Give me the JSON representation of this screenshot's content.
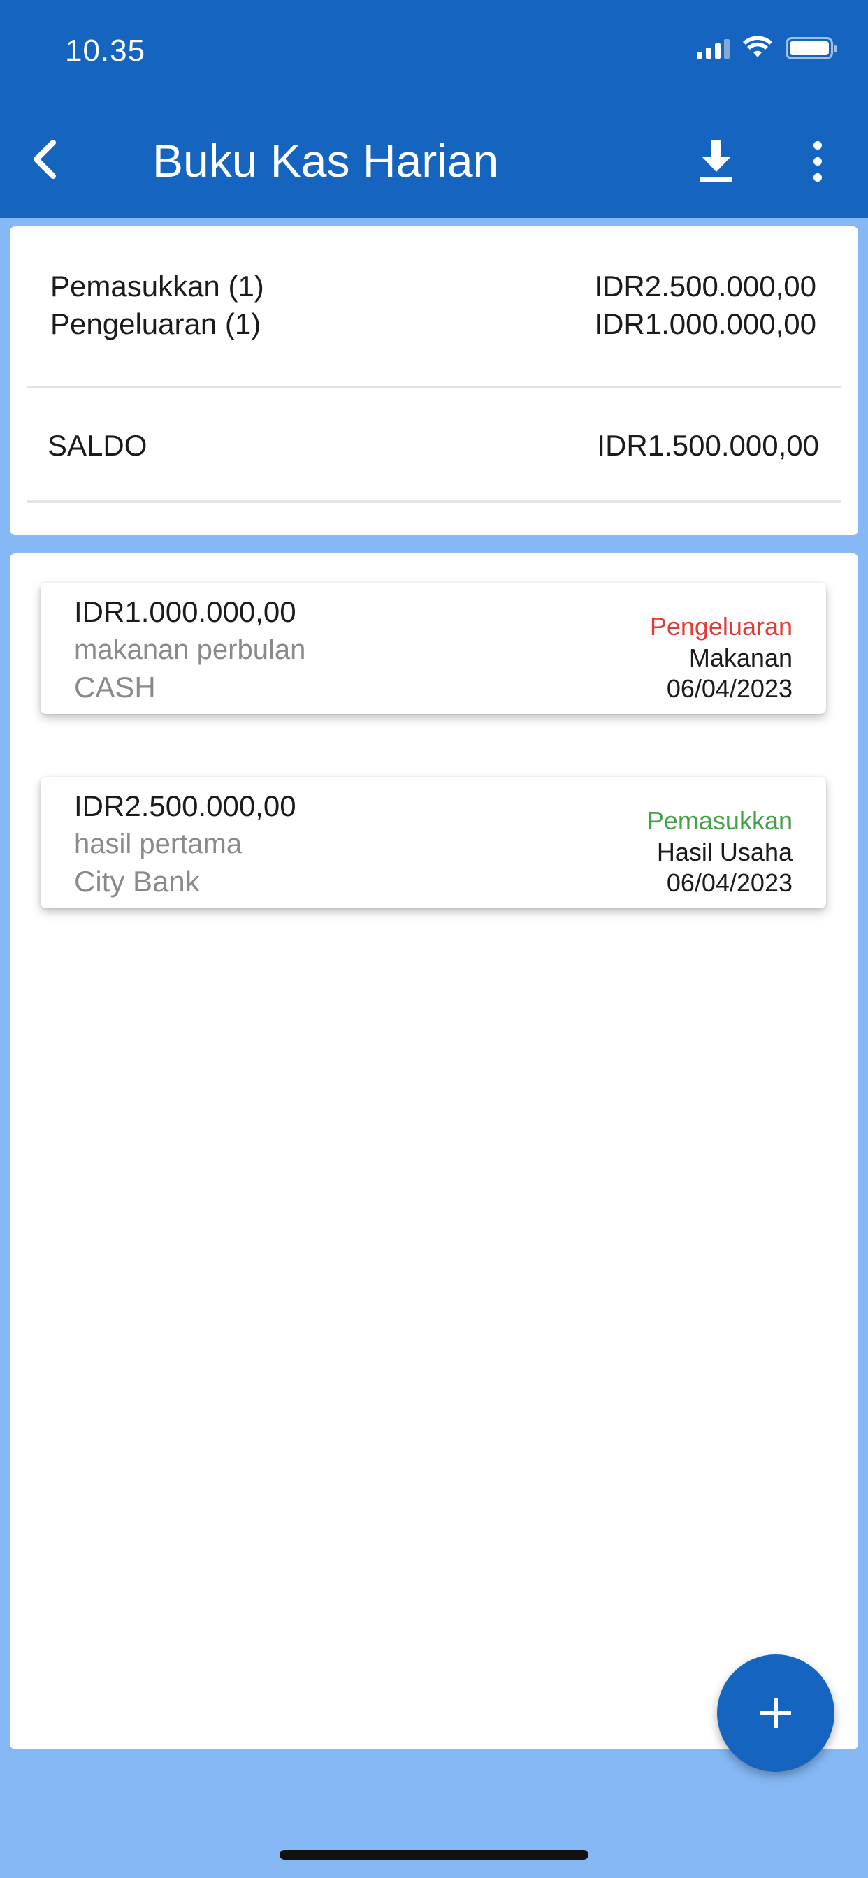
{
  "status_bar": {
    "time": "10.35"
  },
  "header": {
    "title": "Buku Kas Harian"
  },
  "summary": {
    "income_label": "Pemasukkan (1)",
    "income_amount": "IDR2.500.000,00",
    "expense_label": "Pengeluaran (1)",
    "expense_amount": "IDR1.000.000,00",
    "balance_label": "SALDO",
    "balance_amount": "IDR1.500.000,00"
  },
  "transactions": [
    {
      "amount": "IDR1.000.000,00",
      "note": "makanan perbulan",
      "account": "CASH",
      "type": "Pengeluaran",
      "category": "Makanan",
      "date": "06/04/2023"
    },
    {
      "amount": "IDR2.500.000,00",
      "note": "hasil pertama",
      "account": "City Bank",
      "type": "Pemasukkan",
      "category": "Hasil Usaha",
      "date": "06/04/2023"
    }
  ],
  "colors": {
    "primary": "#1565c0",
    "background": "#85b8f5",
    "expense": "#e53935",
    "income": "#43a047"
  },
  "icons": {
    "back": "back-arrow-icon",
    "download": "download-icon",
    "menu": "more-vert-icon",
    "add": "plus-icon"
  }
}
